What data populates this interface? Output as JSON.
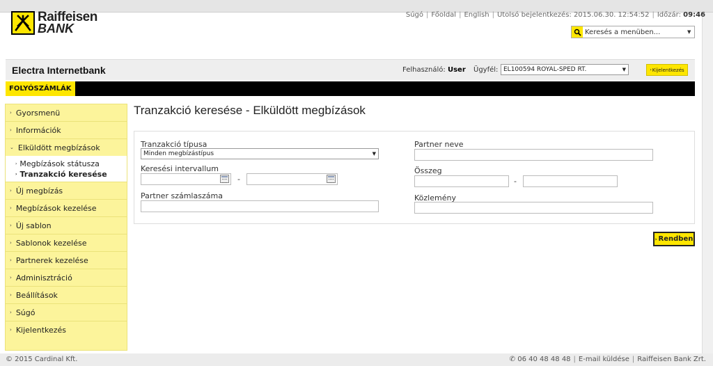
{
  "brand": {
    "line1": "Raiffeisen",
    "line2": "BANK"
  },
  "toplinks": {
    "help": "Súgó",
    "home": "Főoldal",
    "english": "English",
    "last_login": "Utolsó bejelentkezés: 2015.06.30. 12:54:52",
    "time_label": "Időzár:",
    "time_value": "09:46"
  },
  "menu_search": {
    "placeholder": "Keresés a menüben..."
  },
  "header": {
    "app_title": "Electra Internetbank",
    "user_label": "Felhasználó:",
    "user_value": "User",
    "client_label": "Ügyfél:",
    "client_value": "EL100594 ROYAL-SPED RT.",
    "logout": "Kijelentkezés"
  },
  "tab": {
    "label": "FOLYÓSZÁMLÁK"
  },
  "sidebar": {
    "items": [
      {
        "label": "Gyorsmenü"
      },
      {
        "label": "Információk"
      },
      {
        "label": "Elküldött megbízások"
      },
      {
        "label": "Új megbízás"
      },
      {
        "label": "Megbízások kezelése"
      },
      {
        "label": "Új sablon"
      },
      {
        "label": "Sablonok kezelése"
      },
      {
        "label": "Partnerek kezelése"
      },
      {
        "label": "Adminisztráció"
      },
      {
        "label": "Beállítások"
      },
      {
        "label": "Súgó"
      },
      {
        "label": "Kijelentkezés"
      }
    ],
    "subitems": [
      {
        "label": "Megbízások státusza"
      },
      {
        "label": "Tranzakció keresése"
      }
    ]
  },
  "page": {
    "title": "Tranzakció keresése - Elküldött megbízások"
  },
  "form": {
    "tx_type_label": "Tranzakció típusa",
    "tx_type_value": "Minden megbízástípus",
    "interval_label": "Keresési intervallum",
    "partner_account_label": "Partner számlaszáma",
    "partner_name_label": "Partner neve",
    "amount_label": "Összeg",
    "comment_label": "Közlemény",
    "dash": "-"
  },
  "actions": {
    "ok": "Rendben"
  },
  "footer": {
    "copyright": "© 2015 Cardinal Kft.",
    "phone": "06 40 48 48 48",
    "email": "E-mail küldése",
    "company": "Raiffeisen Bank Zrt."
  },
  "colors": {
    "brand_yellow": "#fee600",
    "menu_yellow": "#fcf49b",
    "bar_black": "#000000"
  }
}
